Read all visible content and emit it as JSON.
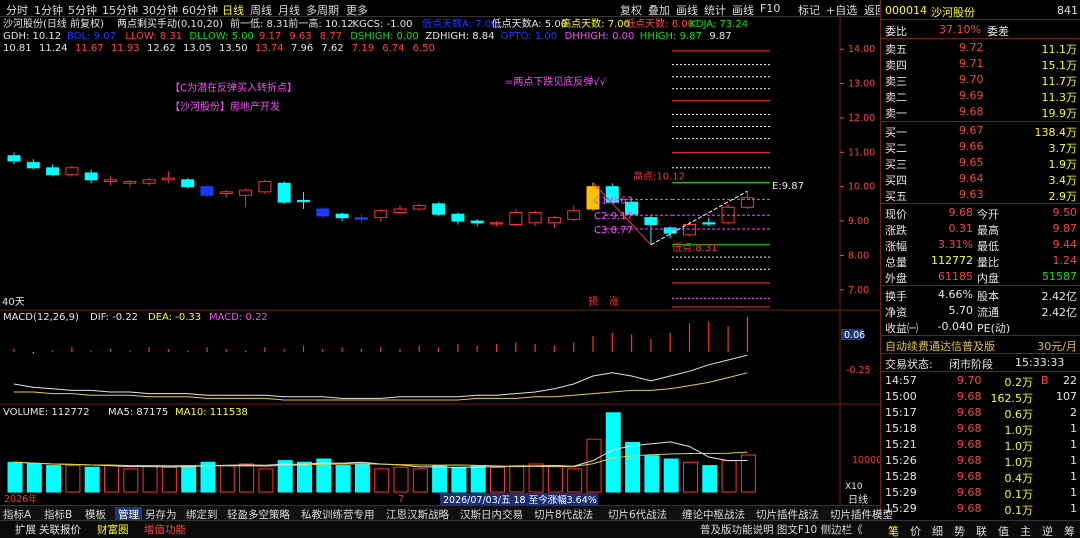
{
  "toolbar": {
    "periods": [
      "分时",
      "1分钟",
      "5分钟",
      "15分钟",
      "30分钟",
      "60分钟",
      "日线",
      "周线",
      "月线",
      "多周期",
      "更多"
    ],
    "active_period": "日线",
    "tools": [
      "复权",
      "叠加",
      "画线",
      "统计",
      "画线",
      "F10",
      "标记",
      "+自选",
      "返回"
    ]
  },
  "main": {
    "title": "沙河股份(日线 前复权)",
    "indicator_name": "两点剩买手动(0,10,20)",
    "line1": [
      {
        "t": "前一低: 8.31",
        "c": "#e6e6e6"
      },
      {
        "t": "前一高: 10.12",
        "c": "#e6e6e6"
      },
      {
        "t": "KGCS: -1.00",
        "c": "#e6e6e6"
      },
      {
        "t": "低点天数A: 7.00",
        "c": "#1a3aff"
      },
      {
        "t": "低点天数A: 5.00",
        "c": "#e6e6e6"
      },
      {
        "t": "高点天数: 7.00",
        "c": "#ffff00"
      },
      {
        "t": "低点天数: 6.00",
        "c": "#ff4040"
      },
      {
        "t": "KDJA: 73.24",
        "c": "#00e600"
      }
    ],
    "line2": [
      {
        "t": "GDH: 10.12",
        "c": "#e6e6e6"
      },
      {
        "t": "BOL: 9.07",
        "c": "#1a3aff"
      },
      {
        "t": "LLOW: 8.31",
        "c": "#ff4040"
      },
      {
        "t": "DLLOW: 5.00",
        "c": "#00e600"
      },
      {
        "t": "9.17",
        "c": "#ff4040"
      },
      {
        "t": "9.63",
        "c": "#ff4040"
      },
      {
        "t": "8.77",
        "c": "#ff4040"
      },
      {
        "t": "DSHIGH: 0.00",
        "c": "#00e600"
      },
      {
        "t": "ZDHIGH: 8.84",
        "c": "#e6e6e6"
      },
      {
        "t": "OPTO: 1.00",
        "c": "#1a3aff"
      },
      {
        "t": "DHHIGH: 0.00",
        "c": "#ff44ff"
      },
      {
        "t": "HHIGH: 9.87",
        "c": "#00e600"
      },
      {
        "t": "9.87",
        "c": "#e6e6e6"
      }
    ],
    "line3": [
      {
        "t": "10.81",
        "c": "#e6e6e6"
      },
      {
        "t": "11.24",
        "c": "#e6e6e6"
      },
      {
        "t": "11.67",
        "c": "#ff4040"
      },
      {
        "t": "11.93",
        "c": "#ff4040"
      },
      {
        "t": "12.62",
        "c": "#e6e6e6"
      },
      {
        "t": "13.05",
        "c": "#e6e6e6"
      },
      {
        "t": "13.50",
        "c": "#e6e6e6"
      },
      {
        "t": "13.74",
        "c": "#ff4040"
      },
      {
        "t": "7.96",
        "c": "#e6e6e6"
      },
      {
        "t": "7.62",
        "c": "#e6e6e6"
      },
      {
        "t": "7.19",
        "c": "#ff4040"
      },
      {
        "t": "6.74",
        "c": "#ff4040"
      },
      {
        "t": "6.50",
        "c": "#ff4040"
      }
    ],
    "annot1": "【C为潜在反弹买入转折点】",
    "annot2": "【沙河股份】房地产开发",
    "annot3": "=两点下跌见底反弹√√",
    "high_label": "高点:10.12",
    "low_label": "低点:8.31",
    "c1": "C1:9.63",
    "c2": "C2:9.17",
    "c3": "C3:8.77",
    "e_label": "E:9.87",
    "days_label": "40天",
    "pre_label": "预",
    "rise_label": "涨",
    "y_ticks": [
      "14.00",
      "13.00",
      "12.00",
      "11.00",
      "10.00",
      "9.00",
      "8.00",
      "7.00"
    ],
    "bars": [
      {
        "o": 10.9,
        "c": 10.75,
        "h": 11.0,
        "l": 10.65
      },
      {
        "o": 10.7,
        "c": 10.55,
        "h": 10.8,
        "l": 10.5
      },
      {
        "o": 10.55,
        "c": 10.35,
        "h": 10.65,
        "l": 10.3
      },
      {
        "o": 10.35,
        "c": 10.55,
        "h": 10.6,
        "l": 10.3
      },
      {
        "o": 10.4,
        "c": 10.2,
        "h": 10.5,
        "l": 10.1
      },
      {
        "o": 10.2,
        "c": 10.15,
        "h": 10.3,
        "l": 10.05
      },
      {
        "o": 10.15,
        "c": 10.1,
        "h": 10.2,
        "l": 10.0
      },
      {
        "o": 10.1,
        "c": 10.2,
        "h": 10.25,
        "l": 10.05
      },
      {
        "o": 10.25,
        "c": 10.2,
        "h": 10.45,
        "l": 10.1
      },
      {
        "o": 10.2,
        "c": 10.0,
        "h": 10.25,
        "l": 9.95
      },
      {
        "o": 10.0,
        "c": 9.75,
        "h": 10.05,
        "l": 9.7
      },
      {
        "o": 9.8,
        "c": 9.85,
        "h": 9.9,
        "l": 9.7
      },
      {
        "o": 9.75,
        "c": 9.9,
        "h": 9.95,
        "l": 9.4
      },
      {
        "o": 9.85,
        "c": 10.15,
        "h": 10.2,
        "l": 9.8
      },
      {
        "o": 10.1,
        "c": 9.55,
        "h": 10.15,
        "l": 9.5
      },
      {
        "o": 9.6,
        "c": 9.6,
        "h": 9.85,
        "l": 9.35
      },
      {
        "o": 9.35,
        "c": 9.15,
        "h": 9.4,
        "l": 9.1
      },
      {
        "o": 9.2,
        "c": 9.1,
        "h": 9.25,
        "l": 9.0
      },
      {
        "o": 9.1,
        "c": 9.05,
        "h": 9.2,
        "l": 8.95
      },
      {
        "o": 9.1,
        "c": 9.3,
        "h": 9.35,
        "l": 9.0
      },
      {
        "o": 9.25,
        "c": 9.35,
        "h": 9.45,
        "l": 9.2
      },
      {
        "o": 9.35,
        "c": 9.45,
        "h": 9.5,
        "l": 9.3
      },
      {
        "o": 9.5,
        "c": 9.2,
        "h": 9.55,
        "l": 9.15
      },
      {
        "o": 9.2,
        "c": 9.0,
        "h": 9.25,
        "l": 8.9
      },
      {
        "o": 9.0,
        "c": 8.95,
        "h": 9.05,
        "l": 8.85
      },
      {
        "o": 8.95,
        "c": 8.95,
        "h": 9.0,
        "l": 8.85
      },
      {
        "o": 8.9,
        "c": 9.25,
        "h": 9.35,
        "l": 8.85
      },
      {
        "o": 9.25,
        "c": 8.95,
        "h": 9.3,
        "l": 8.85
      },
      {
        "o": 8.95,
        "c": 9.1,
        "h": 9.15,
        "l": 8.8
      },
      {
        "o": 9.05,
        "c": 9.3,
        "h": 9.45,
        "l": 9.0
      },
      {
        "o": 9.35,
        "c": 10.0,
        "h": 10.12,
        "l": 9.3
      },
      {
        "o": 10.0,
        "c": 9.55,
        "h": 10.1,
        "l": 9.5
      },
      {
        "o": 9.55,
        "c": 9.2,
        "h": 9.6,
        "l": 9.15
      },
      {
        "o": 9.1,
        "c": 8.9,
        "h": 9.15,
        "l": 8.31
      },
      {
        "o": 8.8,
        "c": 8.65,
        "h": 8.85,
        "l": 8.5
      },
      {
        "o": 8.6,
        "c": 8.9,
        "h": 9.0,
        "l": 8.55
      },
      {
        "o": 8.95,
        "c": 8.95,
        "h": 9.1,
        "l": 8.85
      },
      {
        "o": 8.95,
        "c": 9.4,
        "h": 9.5,
        "l": 8.9
      },
      {
        "o": 9.4,
        "c": 9.68,
        "h": 9.87,
        "l": 9.35
      }
    ],
    "bar_colors": [
      "cyan",
      "cyan",
      "cyan",
      "red",
      "cyan",
      "red",
      "red",
      "red",
      "red",
      "cyan",
      "blue",
      "red",
      "red",
      "red",
      "cyan",
      "cyan",
      "blue",
      "cyan",
      "blue",
      "red",
      "red",
      "red",
      "cyan",
      "cyan",
      "cyan",
      "red",
      "red",
      "red",
      "red",
      "red",
      "yellow",
      "cyan",
      "cyan",
      "cyan",
      "cyan",
      "red",
      "cyan",
      "red",
      "red"
    ]
  },
  "macd": {
    "label": "MACD(12,26,9)",
    "dif": "DIF: -0.22",
    "dea": "DEA: -0.33",
    "macd": "MACD: 0.22",
    "tick_top": "0.06",
    "tick_bottom": "-0.25",
    "hist": [
      0.02,
      -0.01,
      0.01,
      0.03,
      0.01,
      0.02,
      0.01,
      0.03,
      0.02,
      0.01,
      0.03,
      0.02,
      0.01,
      0.03,
      0.02,
      0.04,
      0.02,
      0.03,
      0.02,
      0.03,
      0.02,
      0.04,
      0.03,
      0.05,
      0.04,
      0.05,
      0.06,
      0.05,
      0.04,
      0.06,
      0.1,
      0.12,
      0.11,
      0.08,
      0.12,
      0.18,
      0.19,
      0.16,
      0.22
    ],
    "dif_line": [
      -0.4,
      -0.42,
      -0.43,
      -0.44,
      -0.44,
      -0.45,
      -0.45,
      -0.46,
      -0.46,
      -0.46,
      -0.47,
      -0.47,
      -0.47,
      -0.47,
      -0.48,
      -0.48,
      -0.48,
      -0.49,
      -0.49,
      -0.49,
      -0.48,
      -0.48,
      -0.48,
      -0.48,
      -0.47,
      -0.47,
      -0.46,
      -0.45,
      -0.43,
      -0.4,
      -0.35,
      -0.33,
      -0.35,
      -0.38,
      -0.35,
      -0.32,
      -0.28,
      -0.25,
      -0.22
    ],
    "dea_line": [
      -0.45,
      -0.45,
      -0.46,
      -0.46,
      -0.47,
      -0.47,
      -0.47,
      -0.48,
      -0.48,
      -0.48,
      -0.49,
      -0.49,
      -0.49,
      -0.49,
      -0.5,
      -0.5,
      -0.5,
      -0.5,
      -0.5,
      -0.5,
      -0.5,
      -0.5,
      -0.5,
      -0.5,
      -0.49,
      -0.49,
      -0.49,
      -0.48,
      -0.48,
      -0.47,
      -0.46,
      -0.45,
      -0.44,
      -0.44,
      -0.43,
      -0.41,
      -0.39,
      -0.36,
      -0.33
    ]
  },
  "volume": {
    "label": "VOLUME: 112772",
    "ma5": "MA5: 87175",
    "ma10": "MA10: 111538",
    "tick": "10000",
    "x10": "X10",
    "bars": [
      90,
      85,
      80,
      80,
      75,
      80,
      70,
      80,
      75,
      80,
      90,
      80,
      85,
      70,
      95,
      90,
      100,
      80,
      85,
      70,
      75,
      70,
      80,
      75,
      80,
      75,
      80,
      85,
      80,
      70,
      160,
      240,
      150,
      110,
      100,
      90,
      80,
      95,
      112
    ],
    "colors": [
      "cyan",
      "cyan",
      "cyan",
      "red",
      "cyan",
      "red",
      "red",
      "red",
      "red",
      "cyan",
      "cyan",
      "red",
      "red",
      "red",
      "cyan",
      "cyan",
      "cyan",
      "cyan",
      "cyan",
      "red",
      "red",
      "red",
      "cyan",
      "cyan",
      "cyan",
      "red",
      "red",
      "red",
      "red",
      "red",
      "red",
      "cyan",
      "cyan",
      "cyan",
      "cyan",
      "red",
      "cyan",
      "red",
      "red"
    ],
    "start_date": "2026年",
    "date_mark": "7",
    "period_info": "2026/07/03/五 18 至今涨幅3.64%",
    "footer_label": "日线"
  },
  "tabs_row1": [
    "指标A",
    "指标B",
    "模板",
    "管理",
    "另存为",
    "绑定到",
    "轻盈多空策略",
    "私教训练营专用",
    "江恩汉斯战略",
    "汉斯日内交易",
    "切片8代战法",
    "切片6代战法",
    "缠论中枢战法",
    "切片插件战法",
    "切片插件模型"
  ],
  "tabs_row1_selected": "管理",
  "tabs_row2": [
    "扩展",
    "关联报价",
    "财富圈",
    "增值功能"
  ],
  "tabs_row2_right": "普及版功能说明  图文F10  侧边栏《",
  "right_tabs": [
    "笔",
    "价",
    "细",
    "势",
    "联",
    "值",
    "主",
    "逆",
    "筹"
  ],
  "quote": {
    "code": "000014",
    "name": "沙河股份",
    "corner": "841",
    "wei_bi_label": "委比",
    "wei_bi": "37.10%",
    "wei_cha_label": "委差",
    "sell": [
      {
        "label": "卖五",
        "price": "9.72",
        "vol": "11.1万"
      },
      {
        "label": "卖四",
        "price": "9.71",
        "vol": "15.1万"
      },
      {
        "label": "卖三",
        "price": "9.70",
        "vol": "11.7万"
      },
      {
        "label": "卖二",
        "price": "9.69",
        "vol": "11.3万"
      },
      {
        "label": "卖一",
        "price": "9.68",
        "vol": "19.9万"
      }
    ],
    "buy": [
      {
        "label": "买一",
        "price": "9.67",
        "vol": "138.4万"
      },
      {
        "label": "买二",
        "price": "9.66",
        "vol": "3.7万"
      },
      {
        "label": "买三",
        "price": "9.65",
        "vol": "1.9万"
      },
      {
        "label": "买四",
        "price": "9.64",
        "vol": "3.4万"
      },
      {
        "label": "买五",
        "price": "9.63",
        "vol": "2.9万"
      }
    ],
    "stats": [
      {
        "l1": "现价",
        "v1": "9.68",
        "c1": "red",
        "l2": "今开",
        "v2": "9.50",
        "c2": "red"
      },
      {
        "l1": "涨跌",
        "v1": "0.31",
        "c1": "red",
        "l2": "最高",
        "v2": "9.87",
        "c2": "red"
      },
      {
        "l1": "涨幅",
        "v1": "3.31%",
        "c1": "red",
        "l2": "最低",
        "v2": "9.44",
        "c2": "red"
      },
      {
        "l1": "总量",
        "v1": "112772",
        "c1": "yellow",
        "l2": "量比",
        "v2": "1.24",
        "c2": "red"
      },
      {
        "l1": "外盘",
        "v1": "61185",
        "c1": "red",
        "l2": "内盘",
        "v2": "51587",
        "c2": "green"
      }
    ],
    "stats2": [
      {
        "l1": "换手",
        "v1": "4.66%",
        "l2": "股本",
        "v2": "2.42亿"
      },
      {
        "l1": "净资",
        "v1": "5.70",
        "l2": "流通",
        "v2": "2.42亿"
      },
      {
        "l1": "收益㈠",
        "v1": "-0.040",
        "l2": "PE(动)",
        "v2": ""
      }
    ],
    "ad": "自动续费通达信普及版",
    "ad_price": "30元/月",
    "status_label": "交易状态:",
    "status": "闭市阶段",
    "status_time": "15:33:33",
    "ticks": [
      {
        "t": "14:57",
        "p": "9.70",
        "v": "0.2万",
        "f": "B",
        "n": "22"
      },
      {
        "t": "15:00",
        "p": "9.68",
        "v": "162.5万",
        "f": "",
        "n": "107"
      },
      {
        "t": "15:17",
        "p": "9.68",
        "v": "0.6万",
        "f": "",
        "n": "2"
      },
      {
        "t": "15:18",
        "p": "9.68",
        "v": "1.0万",
        "f": "",
        "n": "1"
      },
      {
        "t": "15:21",
        "p": "9.68",
        "v": "1.0万",
        "f": "",
        "n": "1"
      },
      {
        "t": "15:26",
        "p": "9.68",
        "v": "1.0万",
        "f": "",
        "n": "1"
      },
      {
        "t": "15:28",
        "p": "9.68",
        "v": "0.4万",
        "f": "",
        "n": "1"
      },
      {
        "t": "15:29",
        "p": "9.68",
        "v": "0.1万",
        "f": "",
        "n": "1"
      },
      {
        "t": "15:29",
        "p": "9.68",
        "v": "0.1万",
        "f": "",
        "n": "1"
      }
    ]
  }
}
